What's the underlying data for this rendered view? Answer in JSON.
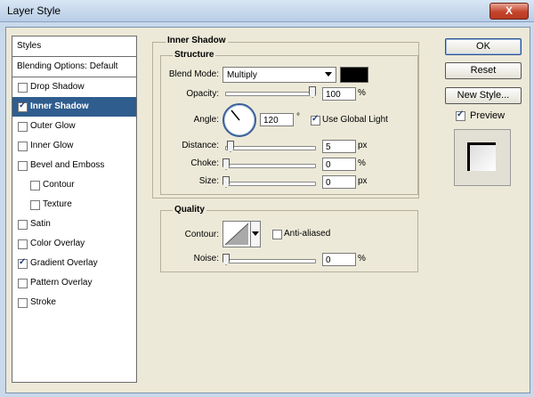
{
  "window": {
    "title": "Layer Style",
    "close_label": "X"
  },
  "styles_panel": {
    "header": "Styles",
    "blending_options": "Blending Options: Default",
    "items": [
      {
        "label": "Drop Shadow",
        "checked": false,
        "selected": false,
        "indent": false
      },
      {
        "label": "Inner Shadow",
        "checked": true,
        "selected": true,
        "indent": false
      },
      {
        "label": "Outer Glow",
        "checked": false,
        "selected": false,
        "indent": false
      },
      {
        "label": "Inner Glow",
        "checked": false,
        "selected": false,
        "indent": false
      },
      {
        "label": "Bevel and Emboss",
        "checked": false,
        "selected": false,
        "indent": false
      },
      {
        "label": "Contour",
        "checked": false,
        "selected": false,
        "indent": true
      },
      {
        "label": "Texture",
        "checked": false,
        "selected": false,
        "indent": true
      },
      {
        "label": "Satin",
        "checked": false,
        "selected": false,
        "indent": false
      },
      {
        "label": "Color Overlay",
        "checked": false,
        "selected": false,
        "indent": false
      },
      {
        "label": "Gradient Overlay",
        "checked": true,
        "selected": false,
        "indent": false
      },
      {
        "label": "Pattern Overlay",
        "checked": false,
        "selected": false,
        "indent": false
      },
      {
        "label": "Stroke",
        "checked": false,
        "selected": false,
        "indent": false
      }
    ]
  },
  "inner_shadow": {
    "title": "Inner Shadow",
    "structure_title": "Structure",
    "blend_mode_label": "Blend Mode:",
    "blend_mode_value": "Multiply",
    "shadow_color": "#000000",
    "opacity_label": "Opacity:",
    "opacity_value": "100",
    "opacity_unit": "%",
    "opacity_level": 1.0,
    "angle_label": "Angle:",
    "angle_value": "120",
    "angle_unit": "°",
    "use_global_light_label": "Use Global Light",
    "use_global_light_checked": true,
    "distance_label": "Distance:",
    "distance_value": "5",
    "distance_unit": "px",
    "distance_level": 0.02,
    "choke_label": "Choke:",
    "choke_value": "0",
    "choke_unit": "%",
    "choke_level": 0.0,
    "size_label": "Size:",
    "size_value": "0",
    "size_unit": "px",
    "size_level": 0.0
  },
  "quality": {
    "title": "Quality",
    "contour_label": "Contour:",
    "anti_aliased_label": "Anti-aliased",
    "anti_aliased_checked": false,
    "noise_label": "Noise:",
    "noise_value": "0",
    "noise_unit": "%",
    "noise_level": 0.0
  },
  "actions": {
    "ok_label": "OK",
    "reset_label": "Reset",
    "new_style_label": "New Style...",
    "preview_label": "Preview",
    "preview_checked": true
  }
}
